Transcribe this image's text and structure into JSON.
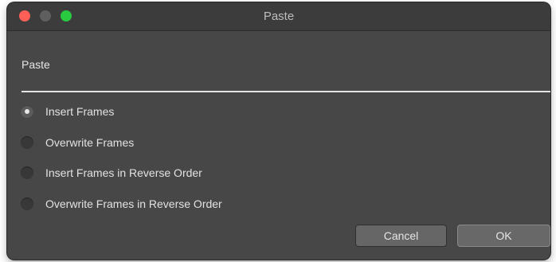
{
  "window": {
    "title": "Paste"
  },
  "section": {
    "label": "Paste"
  },
  "options": [
    {
      "label": "Insert Frames",
      "checked": true
    },
    {
      "label": "Overwrite Frames",
      "checked": false
    },
    {
      "label": "Insert Frames in Reverse Order",
      "checked": false
    },
    {
      "label": "Overwrite Frames in Reverse Order",
      "checked": false
    }
  ],
  "buttons": {
    "cancel_label": "Cancel",
    "ok_label": "OK"
  },
  "colors": {
    "window_bg": "#474747",
    "close": "#fe5f57",
    "minimize": "#5f5f5f",
    "maximize": "#29c940"
  }
}
